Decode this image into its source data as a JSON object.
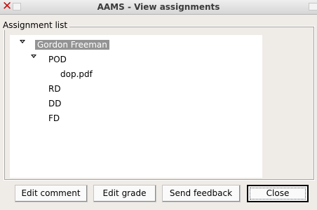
{
  "window": {
    "title": "AAMS - View assignments"
  },
  "group": {
    "title": "Assignment list"
  },
  "tree": {
    "root": {
      "label": "Gordon Freeman",
      "expanded": true,
      "selected": true
    },
    "categories": [
      {
        "label": "POD",
        "expanded": true,
        "children": [
          {
            "label": "dop.pdf"
          }
        ]
      },
      {
        "label": "RD"
      },
      {
        "label": "DD"
      },
      {
        "label": "FD"
      }
    ]
  },
  "buttons": {
    "edit_comment": "Edit comment",
    "edit_grade": "Edit grade",
    "send_feedback": "Send feedback",
    "close": "Close"
  },
  "colors": {
    "selection": "#939393",
    "close_icon": "#c41010",
    "window_bg": "#efebe7"
  }
}
